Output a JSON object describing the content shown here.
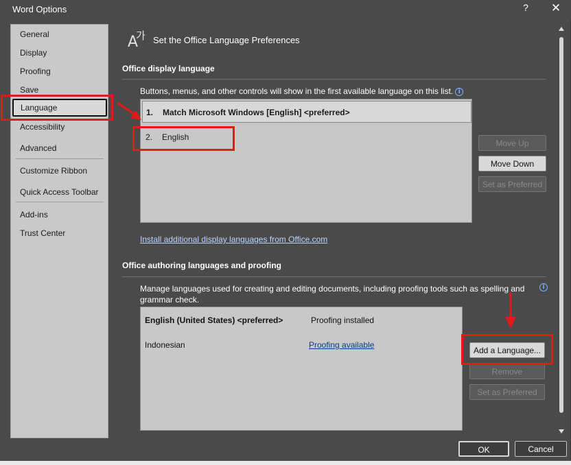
{
  "window": {
    "title": "Word Options",
    "help": "?",
    "close": "✕"
  },
  "sidebar": {
    "items": [
      {
        "label": "General"
      },
      {
        "label": "Display"
      },
      {
        "label": "Proofing"
      },
      {
        "label": "Save"
      },
      {
        "label": "Language",
        "selected": true
      },
      {
        "label": "Accessibility"
      },
      {
        "label": "Advanced"
      },
      {
        "label": "Customize Ribbon"
      },
      {
        "label": "Quick Access Toolbar"
      },
      {
        "label": "Add-ins"
      },
      {
        "label": "Trust Center"
      }
    ]
  },
  "header": {
    "icon": "language-icon",
    "title": "Set the Office Language Preferences"
  },
  "display_language": {
    "section_title": "Office display language",
    "description": "Buttons, menus, and other controls will show in the first available language on this list.",
    "items": [
      {
        "number": "1.",
        "label": "Match Microsoft Windows [English] <preferred>"
      },
      {
        "number": "2.",
        "label": "English"
      }
    ],
    "buttons": {
      "move_up": "Move Up",
      "move_down": "Move Down",
      "set_preferred": "Set as Preferred"
    },
    "install_link": "Install additional display languages from Office.com"
  },
  "authoring": {
    "section_title": "Office authoring languages and proofing",
    "description_line1": "Manage languages used for creating and editing documents, including proofing tools such as spelling and",
    "description_line2": "grammar check.",
    "rows": [
      {
        "language": "English (United States) <preferred>",
        "status": "Proofing installed"
      },
      {
        "language": "Indonesian",
        "status": "Proofing available"
      }
    ],
    "buttons": {
      "add": "Add a Language...",
      "remove": "Remove",
      "set_preferred": "Set as Preferred"
    }
  },
  "footer": {
    "ok": "OK",
    "cancel": "Cancel"
  },
  "colors": {
    "highlight": "#e21a1a",
    "window_bg": "#4a4a4a",
    "panel_bg": "#c8c8c8"
  }
}
